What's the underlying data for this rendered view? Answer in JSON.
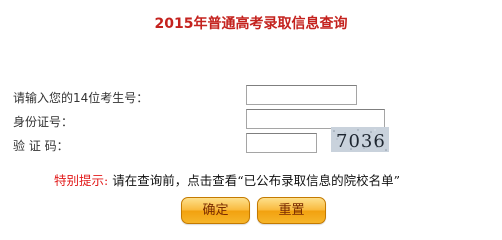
{
  "title": "2015年普通高考录取信息查询",
  "form": {
    "exam_number_label": "请输入您的14位考生号：",
    "exam_number_value": "",
    "id_card_label": "身份证号：",
    "id_card_value": "",
    "captcha_label": "验 证 码：",
    "captcha_value": "",
    "captcha_text": "7036"
  },
  "notice": {
    "hint": "特别提示:",
    "message": " 请在查询前，点击查看“已公布录取信息的院校名单”"
  },
  "buttons": {
    "confirm_label": "确定",
    "reset_label": "重置"
  },
  "colors": {
    "title": "#c4221e",
    "hint": "#e21b1b",
    "button_fill": "#f6b52a"
  }
}
